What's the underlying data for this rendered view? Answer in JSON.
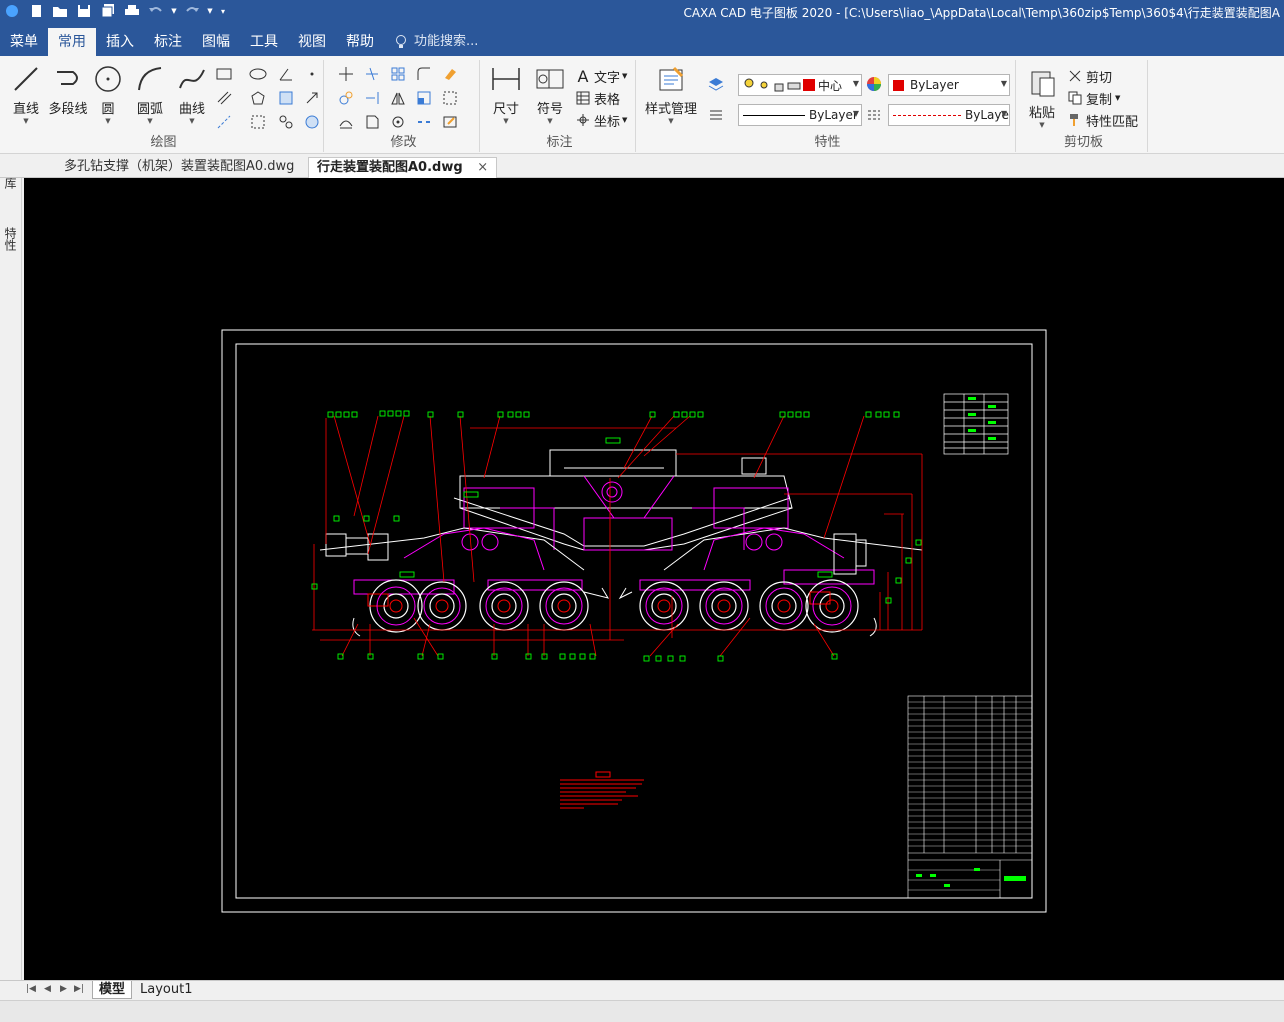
{
  "window": {
    "title": "CAXA CAD 电子图板 2020 - [C:\\Users\\liao_\\AppData\\Local\\Temp\\360zip$Temp\\360$4\\行走装置装配图A"
  },
  "menu_tabs": [
    {
      "label": "菜单"
    },
    {
      "label": "常用",
      "active": true
    },
    {
      "label": "插入"
    },
    {
      "label": "标注"
    },
    {
      "label": "图幅"
    },
    {
      "label": "工具"
    },
    {
      "label": "视图"
    },
    {
      "label": "帮助"
    }
  ],
  "search": {
    "label": "功能搜索..."
  },
  "ribbon": {
    "draw": {
      "group_label": "绘图",
      "line": "直线",
      "polyline": "多段线",
      "circle": "圆",
      "arc": "圆弧",
      "curve": "曲线"
    },
    "modify": {
      "group_label": "修改"
    },
    "annotate": {
      "group_label": "标注",
      "dimension": "尺寸",
      "symbol": "符号",
      "text": "文字",
      "table": "表格",
      "coordinate": "坐标"
    },
    "properties": {
      "group_label": "特性",
      "style_manager": "样式管理",
      "layer_value": "中心",
      "color_value": "ByLayer",
      "linewidth_value": "ByLayer",
      "linetype_value": "ByLaye"
    },
    "clipboard": {
      "group_label": "剪切板",
      "paste": "粘贴",
      "cut": "剪切",
      "copy": "复制",
      "match_props": "特性匹配"
    }
  },
  "doc_tabs": [
    {
      "label": "多孔钻支撑（机架）装置装配图A0.dwg"
    },
    {
      "label": "行走装置装配图A0.dwg",
      "active": true,
      "close": "×"
    }
  ],
  "side_tabs": [
    {
      "label": "图库"
    },
    {
      "label": "特性"
    }
  ],
  "layout_tabs": [
    {
      "label": "模型",
      "active": true
    },
    {
      "label": "Layout1"
    }
  ],
  "colors": {
    "title_bar": "#2b579a",
    "canvas": "#000000",
    "cad_white": "#ffffff",
    "cad_magenta": "#ff00ff",
    "cad_red": "#ff0000",
    "cad_green": "#00ff00"
  }
}
